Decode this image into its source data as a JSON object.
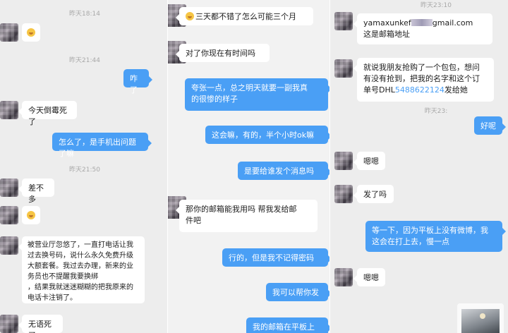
{
  "panel1": {
    "timestamps": [
      "昨天18:14",
      "昨天21:44",
      "昨天21:50"
    ],
    "messages": [
      {
        "side": "in",
        "type": "emoji",
        "icon": "grimace-emoji-icon"
      },
      {
        "side": "out",
        "text": "咋了"
      },
      {
        "side": "in",
        "text": "今天倒霉死了"
      },
      {
        "side": "out",
        "text": "怎么了，是手机出问题了嘛"
      },
      {
        "side": "in",
        "text": "差不多"
      },
      {
        "side": "in",
        "type": "emoji",
        "icon": "grimace-emoji-icon"
      },
      {
        "side": "in",
        "text": "被营业厅忽悠了，一直打电话让我\n过去换号码，说什么永久免费升级\n大额套餐。我过去办理，新来的业\n务员也不提醒我要换绑\n，结果我就迷迷糊糊的把我原来的\n电话卡注销了。"
      },
      {
        "side": "in",
        "text": "无语死了"
      }
    ]
  },
  "panel2": {
    "messages": [
      {
        "side": "in",
        "text": "三天都不错了怎么可能三个月",
        "emoji": "grimace-emoji-icon"
      },
      {
        "side": "in",
        "text": "对了你现在有时间吗"
      },
      {
        "side": "out",
        "text": "夸张一点，总之明天就要一副我真\n的很惨的样子"
      },
      {
        "side": "out",
        "text": "这会嘛，有的，半个小时ok嘛"
      },
      {
        "side": "out",
        "text": "是要给谁发个消息吗"
      },
      {
        "side": "in",
        "text": "那你的邮箱能我用吗  帮我发给邮\n件吧"
      },
      {
        "side": "out",
        "text": "行的，但是我不记得密码"
      },
      {
        "side": "out",
        "text": "我可以帮你发"
      },
      {
        "side": "out",
        "text": "我的邮箱在平板上"
      }
    ]
  },
  "panel3": {
    "timestamps": [
      "昨天23:10",
      "昨天23:"
    ],
    "email_prefix": "yamaxunkef",
    "email_suffix": "gmail.com",
    "email_note": "这是邮箱地址",
    "order_text_1": "就说我朋友抢购了一个包包，想问\n有没有抢到，把我的名字和这个订\n单号DHL",
    "order_number": "5488622124",
    "order_text_2": "发给她",
    "messages": [
      {
        "side": "out",
        "text": "好呢"
      },
      {
        "side": "in",
        "text": "嗯嗯"
      },
      {
        "side": "in",
        "text": "发了吗"
      },
      {
        "side": "out",
        "text": "等一下，因为平板上没有微博，我\n这会在打上去，慢一点"
      },
      {
        "side": "in",
        "text": "嗯嗯"
      }
    ]
  },
  "colors": {
    "accent": "#4a9ff5",
    "bubble_in": "#ffffff",
    "background": "#ededed"
  }
}
